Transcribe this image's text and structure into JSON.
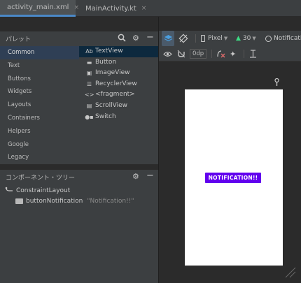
{
  "tabs": [
    {
      "label": "activity_main.xml",
      "close": "×",
      "active": true
    },
    {
      "label": "MainActivity.kt",
      "close": "×",
      "active": false
    }
  ],
  "palette": {
    "title": "パレット",
    "categories": [
      "Common",
      "Text",
      "Buttons",
      "Widgets",
      "Layouts",
      "Containers",
      "Helpers",
      "Google",
      "Legacy"
    ],
    "selected_category": "Common",
    "items": [
      {
        "glyph": "Ab",
        "label": "TextView",
        "icon": "textview-icon"
      },
      {
        "glyph": "▬",
        "label": "Button",
        "icon": "button-icon"
      },
      {
        "glyph": "▣",
        "label": "ImageView",
        "icon": "imageview-icon"
      },
      {
        "glyph": "☰",
        "label": "RecyclerView",
        "icon": "recyclerview-icon"
      },
      {
        "glyph": "<>",
        "label": "<fragment>",
        "icon": "fragment-icon"
      },
      {
        "glyph": "▤",
        "label": "ScrollView",
        "icon": "scrollview-icon"
      },
      {
        "glyph": "●▪",
        "label": "Switch",
        "icon": "switch-icon"
      }
    ]
  },
  "component_tree": {
    "title": "コンポーネント・ツリー",
    "root": "ConstraintLayout",
    "child_name": "buttonNotification",
    "child_hint": "\"Notification!!\""
  },
  "toolbar": {
    "device": "Pixel",
    "api": "30",
    "theme": "Notificati",
    "margin": "0dp"
  },
  "preview": {
    "button_text": "NOTIFICATION!!",
    "button_color": "#6200ee"
  },
  "icons": {
    "search": "search-icon",
    "gear": "gear-icon",
    "minus": "minimize-icon"
  }
}
